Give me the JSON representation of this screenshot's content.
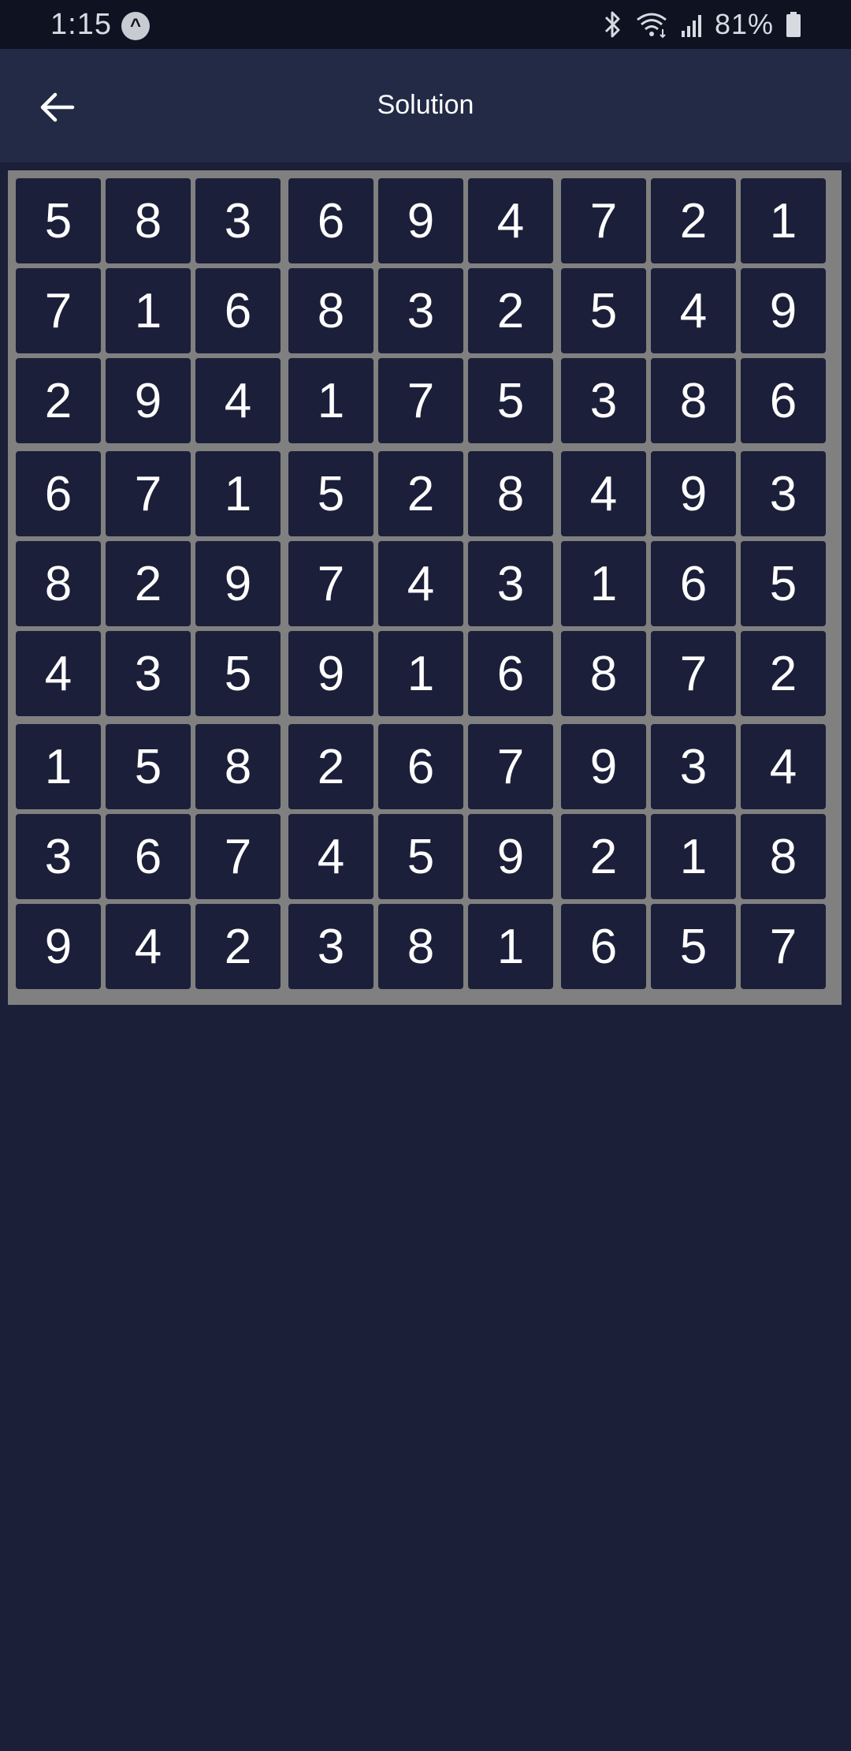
{
  "status_bar": {
    "time": "1:15",
    "app_icon_glyph": "^",
    "battery_percent": "81%",
    "icons": [
      "bluetooth-icon",
      "wifi-icon",
      "signal-icon",
      "battery-icon"
    ]
  },
  "app_bar": {
    "title": "Solution",
    "back_icon": "arrow-left-icon"
  },
  "colors": {
    "background": "#1c1f38",
    "app_bar": "#222a45",
    "status_bar": "#0f1220",
    "grid_border": "#808080",
    "cell": "#1b1f39",
    "text": "#ffffff"
  },
  "solution": [
    [
      5,
      8,
      3,
      6,
      9,
      4,
      7,
      2,
      1
    ],
    [
      7,
      1,
      6,
      8,
      3,
      2,
      5,
      4,
      9
    ],
    [
      2,
      9,
      4,
      1,
      7,
      5,
      3,
      8,
      6
    ],
    [
      6,
      7,
      1,
      5,
      2,
      8,
      4,
      9,
      3
    ],
    [
      8,
      2,
      9,
      7,
      4,
      3,
      1,
      6,
      5
    ],
    [
      4,
      3,
      5,
      9,
      1,
      6,
      8,
      7,
      2
    ],
    [
      1,
      5,
      8,
      2,
      6,
      7,
      9,
      3,
      4
    ],
    [
      3,
      6,
      7,
      4,
      5,
      9,
      2,
      1,
      8
    ],
    [
      9,
      4,
      2,
      3,
      8,
      1,
      6,
      5,
      7
    ]
  ]
}
